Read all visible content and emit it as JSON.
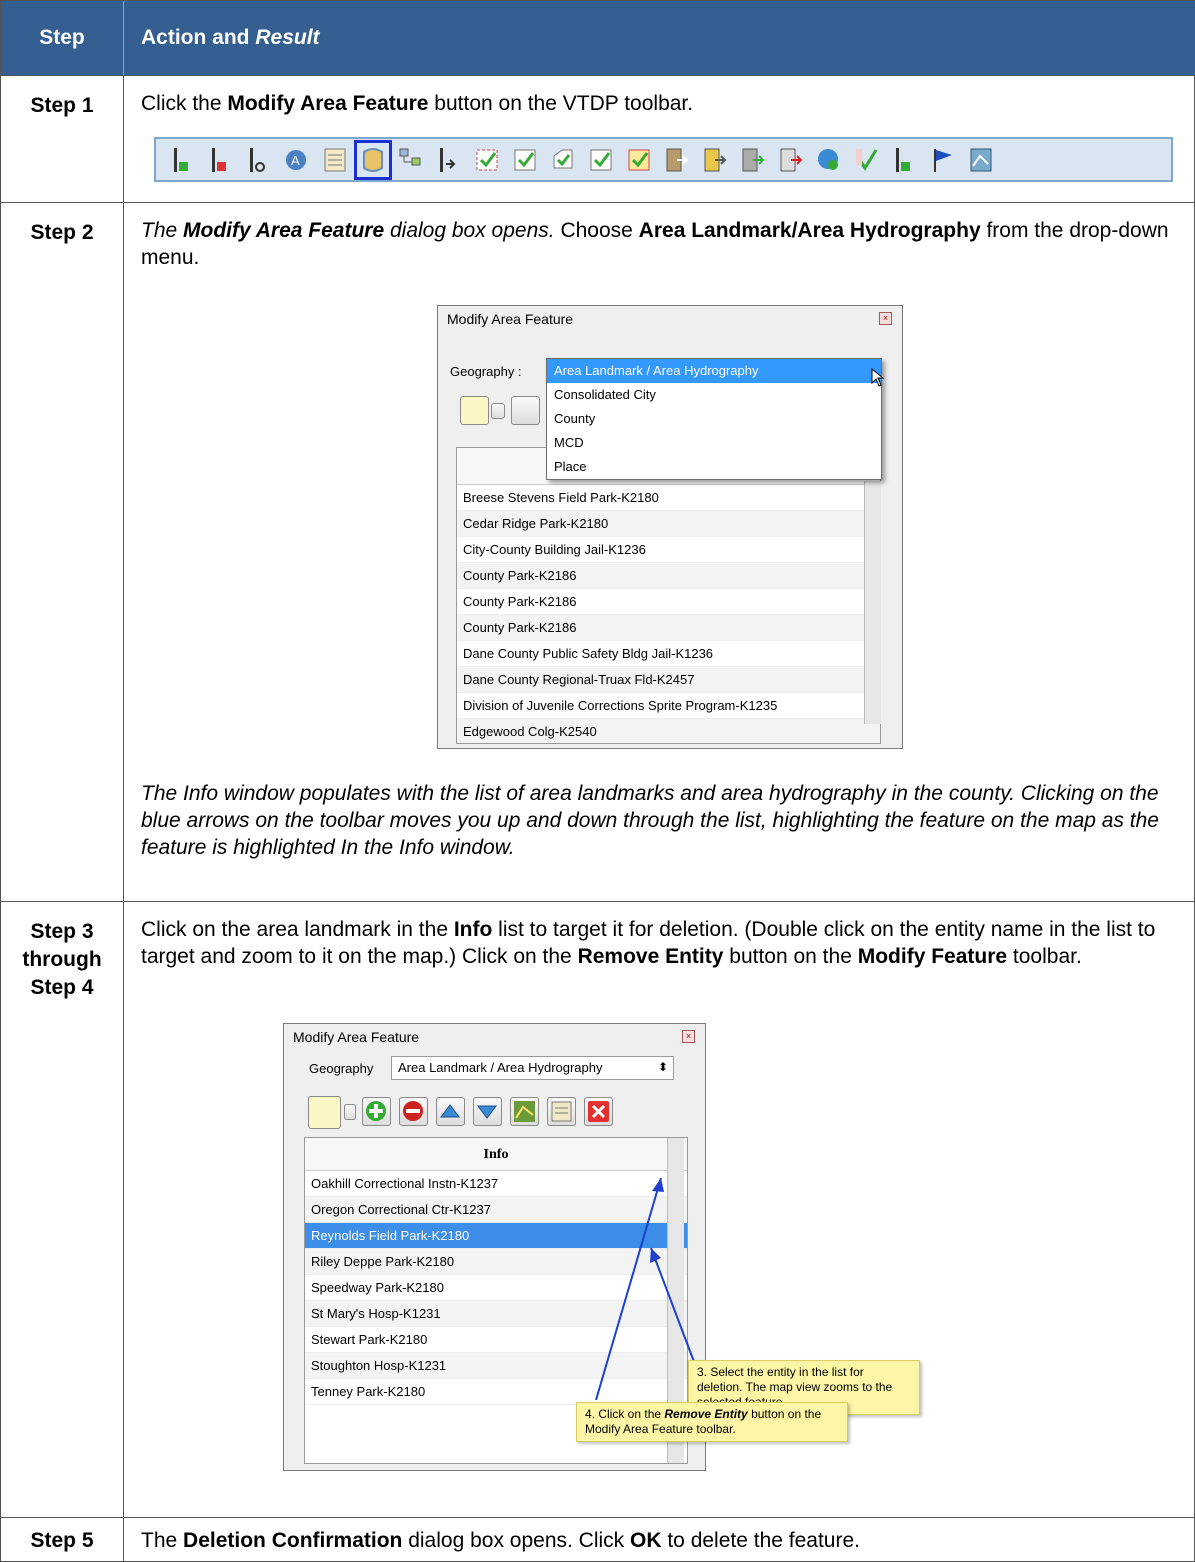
{
  "header": {
    "step": "Step",
    "action_a": "Action and ",
    "action_b": "Result"
  },
  "step1": {
    "label": "Step 1",
    "t1": "Click the ",
    "t2": "Modify Area Feature",
    "t3": " button on the VTDP toolbar."
  },
  "step2": {
    "label": "Step 2",
    "t1": "The ",
    "t2": "Modify Area Feature",
    "t3": " dialog box opens.",
    "t4": " Choose ",
    "t5": "Area Landmark/Area Hydrography",
    "t6": " from the drop-down menu.",
    "dialog": {
      "title": "Modify Area Feature",
      "geo_label": "Geography :",
      "options": [
        "Area Landmark / Area Hydrography",
        "Consolidated City",
        "County",
        "MCD",
        "Place"
      ],
      "items": [
        "Breese Stevens Field Park-K2180",
        "Cedar Ridge Park-K2180",
        "City-County Building Jail-K1236",
        "County Park-K2186",
        "County Park-K2186",
        "County Park-K2186",
        "Dane County Public Safety Bldg Jail-K1236",
        "Dane County Regional-Truax Fld-K2457",
        "Division of Juvenile Corrections Sprite Program-K1235",
        "Edgewood Colg-K2540"
      ]
    },
    "p1": "The ",
    "p2": "Info",
    "p3": " window populates with the list of area landmarks and area hydrography in the county. Clicking on the blue arrows on the toolbar moves you up and down through the list, highlighting the feature on the map as the feature is highlighted In the Info window."
  },
  "step3": {
    "label": "Step 3 through Step 4",
    "t1": "Click on the area landmark in the ",
    "t2": "Info",
    "t3": " list to target it for deletion. (Double click on the entity name in the list to target and zoom to it on the map.) Click on the ",
    "t4": "Remove Entity",
    "t5": " button on the ",
    "t6": "Modify Feature",
    "t7": " toolbar.",
    "dialog": {
      "title": "Modify Area Feature",
      "geo_label": "Geography",
      "combo_value": "Area Landmark / Area Hydrography",
      "col_header": "Info",
      "items": [
        "Oakhill Correctional Instn-K1237",
        "Oregon Correctional Ctr-K1237",
        "Reynolds Field Park-K2180",
        "Riley Deppe Park-K2180",
        "Speedway Park-K2180",
        "St Mary's Hosp-K1231",
        "Stewart Park-K2180",
        "Stoughton Hosp-K1231",
        "Tenney Park-K2180"
      ]
    },
    "note3": "3. Select the entity in the list for deletion. The map view zooms to the selected feature.",
    "note4a": "4.  Click on the ",
    "note4b": "Remove Entity",
    "note4c": " button on the Modify Area Feature toolbar."
  },
  "step5": {
    "label": "Step 5",
    "t1": "The ",
    "t2": "Deletion Confirmation",
    "t3": " dialog box opens. Click ",
    "t4": "OK",
    "t5": " to delete the feature."
  },
  "colors": {
    "header": "#365f91",
    "select": "#3399ff",
    "note": "#fdf6a6"
  }
}
